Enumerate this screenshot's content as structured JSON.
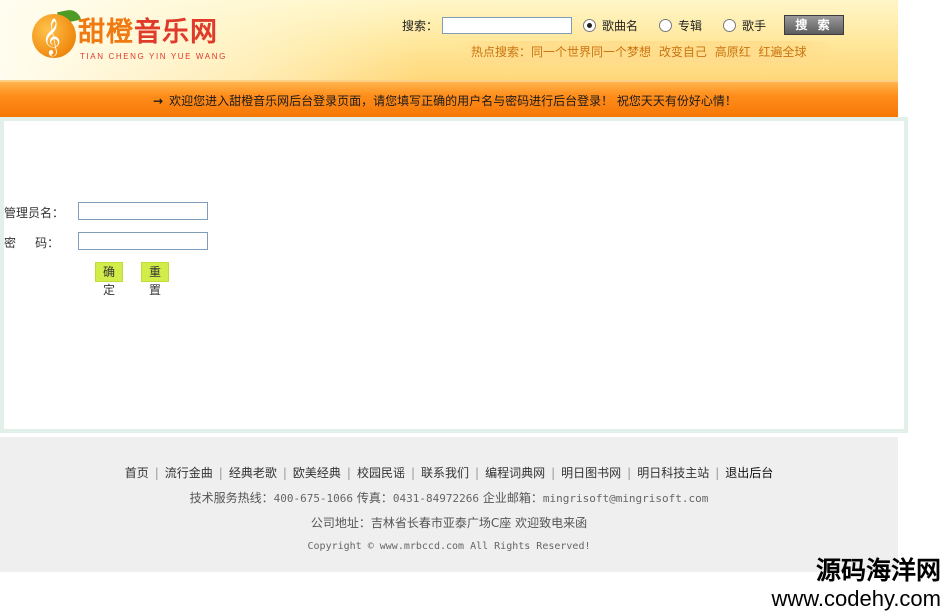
{
  "header": {
    "logo": {
      "fruit_glyph": "𝄞",
      "name_cn_part1": "甜橙",
      "name_cn_part2": "音乐网",
      "pinyin": "TIAN CHENG YIN YUE WANG"
    },
    "search": {
      "label": "搜索：",
      "input_value": "",
      "options": [
        {
          "label": "歌曲名",
          "selected": true
        },
        {
          "label": "专辑",
          "selected": false
        },
        {
          "label": "歌手",
          "selected": false
        }
      ],
      "button_label": "搜 索"
    },
    "hot": {
      "label": "热点搜索：",
      "links": [
        "同一个世界同一个梦想",
        "改变自己",
        "高原红",
        "红遍全球"
      ]
    }
  },
  "notice": {
    "arrow": "→",
    "text": "欢迎您进入甜橙音乐网后台登录页面，请您填写正确的用户名与密码进行后台登录！ 祝您天天有份好心情！"
  },
  "login": {
    "username_label": "管理员名：",
    "username_value": "",
    "password_label": "密     码：",
    "password_value": "",
    "submit_label": "确定",
    "reset_label": "重置"
  },
  "footer": {
    "nav": [
      "首页",
      "流行金曲",
      "经典老歌",
      "欧美经典",
      "校园民谣",
      "联系我们",
      "编程词典网",
      "明日图书网",
      "明日科技主站",
      "退出后台"
    ],
    "hotline_label": "技术服务热线：",
    "hotline": "400-675-1066",
    "fax_label": "传真：",
    "fax": "0431-84972266",
    "email_label": "企业邮箱：",
    "email": "mingrisoft@mingrisoft.com",
    "address": "公司地址：吉林省长春市亚泰广场C座 欢迎致电来函",
    "copyright": "Copyright © www.mrbccd.com All Rights Reserved!"
  },
  "watermark": {
    "cn": "源码海洋网",
    "url": "www.codehy.com"
  },
  "colors": {
    "header_bg": "#ffe79a",
    "notice_bar": "#f57706",
    "button_green": "#d2ec4a",
    "hot_link": "#c97510",
    "footer_bg": "#efefef"
  }
}
